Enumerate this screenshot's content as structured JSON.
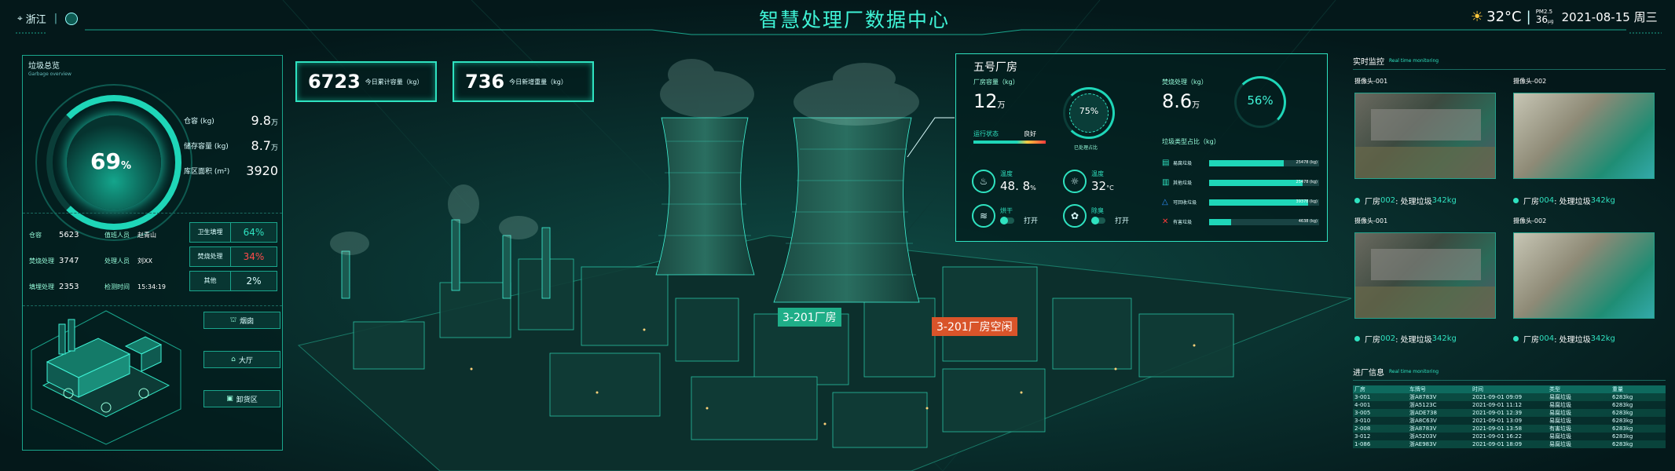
{
  "header": {
    "location": "浙江",
    "title": "智慧处理厂数据中心",
    "temperature": "32°C",
    "pm_label": "PM2.5",
    "pm_value": "36",
    "pm_unit": "μg",
    "date": "2021-08-15 周三"
  },
  "garbage_overview": {
    "title": "垃圾总览",
    "subtitle": "Garbage overview",
    "percent": "69",
    "percent_sign": "%",
    "stats": [
      {
        "label": "仓容 (kg)",
        "value": "9.8",
        "unit": "万"
      },
      {
        "label": "储存容量 (kg)",
        "value": "8.7",
        "unit": "万"
      },
      {
        "label": "库区面积 (m²)",
        "value": "3920",
        "unit": ""
      }
    ],
    "info_rows": [
      {
        "l1": "仓容",
        "v1": "5623",
        "l2": "值班人员",
        "v2": "赵青山"
      },
      {
        "l1": "焚烧处理",
        "v1": "3747",
        "l2": "处理人员",
        "v2": "刘XX"
      },
      {
        "l1": "填埋处理",
        "v1": "2353",
        "l2": "检测时间",
        "v2": "15:34:19"
      }
    ],
    "pills": [
      {
        "label": "卫生填埋",
        "value": "64%",
        "color": "#2fe2c0"
      },
      {
        "label": "焚烧处理",
        "value": "34%",
        "color": "#ff4b4b"
      },
      {
        "label": "其他",
        "value": "2%",
        "color": "#dff"
      }
    ],
    "building_labels": [
      "烟囱",
      "大厅",
      "卸货区"
    ]
  },
  "kpis": [
    {
      "value": "6723",
      "label": "今日累计容量（kg）"
    },
    {
      "value": "736",
      "label": "今日新增重量（kg）"
    }
  ],
  "map_tags": [
    {
      "text": "3-201厂房",
      "color": "#1fae88"
    },
    {
      "text": "3-201厂房空闲",
      "color": "#d9542a"
    }
  ],
  "factory": {
    "title": "五号厂房",
    "capacity_label": "厂房容量（kg）",
    "capacity_value": "12",
    "capacity_unit": "万",
    "status_label": "运行状态",
    "status_value": "良好",
    "processed_pct": "75%",
    "processed_label": "已处理占比",
    "incinerate_label": "焚烧处理（kg）",
    "incinerate_value": "8.6",
    "incinerate_unit": "万",
    "incinerate_pct": "56%",
    "sensors": [
      {
        "label": "温度",
        "value": "48. 8",
        "unit": "%"
      },
      {
        "label": "温度",
        "value": "32",
        "unit": "°C"
      },
      {
        "label": "烘干",
        "value": "打开",
        "unit": ""
      },
      {
        "label": "除臭",
        "value": "打开",
        "unit": ""
      }
    ],
    "types_label": "垃圾类型占比（kg）",
    "types": [
      {
        "icon": "▤",
        "name": "易腐垃圾",
        "value": "25478 (kg)",
        "fraction": 0.68,
        "icon_color": "#2fe2c0"
      },
      {
        "icon": "▥",
        "name": "其他垃圾",
        "value": "25478 (kg)",
        "fraction": 0.85,
        "icon_color": "#2fe2c0"
      },
      {
        "icon": "△",
        "name": "可回收垃圾",
        "value": "39378 (kg)",
        "fraction": 0.9,
        "icon_color": "#2f8fff"
      },
      {
        "icon": "✕",
        "name": "有害垃圾",
        "value": "4638 (kg)",
        "fraction": 0.2,
        "icon_color": "#ff3b3b"
      }
    ]
  },
  "monitoring": {
    "title": "实时监控",
    "subtitle": "Real time monitoring",
    "cameras": [
      {
        "name": "摄像头-001",
        "caption_prefix": "厂房",
        "caption_id": "002",
        "caption_mid": ": 处理垃圾",
        "caption_val": "342kg"
      },
      {
        "name": "摄像头-002",
        "caption_prefix": "厂房",
        "caption_id": "004",
        "caption_mid": ": 处理垃圾",
        "caption_val": "342kg"
      },
      {
        "name": "摄像头-001",
        "caption_prefix": "厂房",
        "caption_id": "002",
        "caption_mid": ": 处理垃圾",
        "caption_val": "342kg"
      },
      {
        "name": "摄像头-002",
        "caption_prefix": "厂房",
        "caption_id": "004",
        "caption_mid": ": 处理垃圾",
        "caption_val": "342kg"
      }
    ]
  },
  "entry": {
    "title": "进厂信息",
    "subtitle": "Real time monitoring",
    "headers": [
      "厂房",
      "车牌号",
      "时间",
      "类型",
      "重量"
    ],
    "rows": [
      [
        "3-001",
        "浙A8783V",
        "2021-09-01 09:09",
        "易腐垃圾",
        "6283kg"
      ],
      [
        "4-001",
        "浙A5123C",
        "2021-09-01 11:12",
        "易腐垃圾",
        "6283kg"
      ],
      [
        "3-005",
        "浙ADE738",
        "2021-09-01 12:39",
        "易腐垃圾",
        "6283kg"
      ],
      [
        "3-010",
        "浙A8C63V",
        "2021-09-01 13:09",
        "易腐垃圾",
        "6283kg"
      ],
      [
        "2-008",
        "浙A8783V",
        "2021-09-01 13:58",
        "有害垃圾",
        "6283kg"
      ],
      [
        "3-012",
        "浙A5203V",
        "2021-09-01 16:22",
        "易腐垃圾",
        "6283kg"
      ],
      [
        "1-086",
        "浙AE983V",
        "2021-09-01 18:09",
        "易腐垃圾",
        "6283kg"
      ]
    ]
  }
}
